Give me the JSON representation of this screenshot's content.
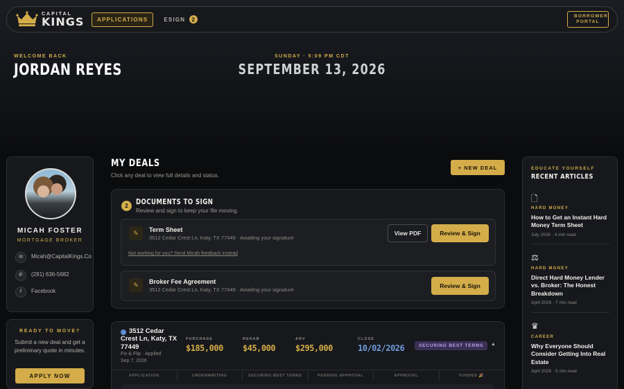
{
  "nav": {
    "logo_top": "CAPITAL",
    "logo_bottom": "KINGS",
    "tabs": [
      {
        "label": "APPLICATIONS",
        "active": true
      },
      {
        "label": "ESIGN",
        "badge": "2"
      }
    ],
    "portal_line1": "BORROWER",
    "portal_line2": "PORTAL"
  },
  "hero": {
    "welcome": "WELCOME BACK",
    "name": "JORDAN REYES",
    "daytime": "SUNDAY · 5:09 PM CDT",
    "date": "SEPTEMBER 13, 2026"
  },
  "profile": {
    "name": "MICAH FOSTER",
    "role": "MORTGAGE BROKER",
    "contacts": [
      {
        "icon": "mail-icon",
        "text": "Micah@CapitalKings.Co"
      },
      {
        "icon": "phone-icon",
        "text": "(281) 636-5682"
      },
      {
        "icon": "facebook-icon",
        "text": "Facebook"
      }
    ]
  },
  "cta": {
    "title": "READY TO MOVE?",
    "text": "Submit a new deal and get a preliminary quote in minutes.",
    "button": "APPLY NOW"
  },
  "main": {
    "title": "MY DEALS",
    "subtitle": "Click any deal to view full details and status.",
    "new_deal": "+ NEW DEAL"
  },
  "docs": {
    "count": "2",
    "title": "DOCUMENTS TO SIGN",
    "subtitle": "Review and sign to keep your file moving.",
    "items": [
      {
        "name": "Term Sheet",
        "meta": "3512 Cedar Crest Ln, Katy, TX 77449 · Awaiting your signature",
        "view": "View PDF",
        "sign": "Review & Sign",
        "feedback": "Not working for you? Send Micah feedback instead"
      },
      {
        "name": "Broker Fee Agreement",
        "meta": "3512 Cedar Crest Ln, Katy, TX 77449 · Awaiting your signature",
        "sign": "Review & Sign"
      }
    ]
  },
  "deal": {
    "address": "3512 Cedar Crest Ln, Katy, TX 77449",
    "type_line": "Fix & Flip · Applied",
    "date_line": "Sep 7, 2026",
    "stats": [
      {
        "label": "PURCHASE",
        "value": "$185,000"
      },
      {
        "label": "REHAB",
        "value": "$45,000"
      },
      {
        "label": "ARV",
        "value": "$295,000"
      },
      {
        "label": "CLOSE",
        "value": "10/02/2026"
      }
    ],
    "status": "SECURING BEST TERMS",
    "steps": [
      "APPLICATION",
      "UNDERWRITING",
      "SECURING BEST TERMS",
      "PENDING APPROVAL",
      "APPROVAL",
      "FUNDED 🎉"
    ]
  },
  "articles": {
    "eyebrow": "EDUCATE YOURSELF",
    "title": "RECENT ARTICLES",
    "items": [
      {
        "icon": "document-icon",
        "category": "HARD MONEY",
        "title": "How to Get an Instant Hard Money Term Sheet",
        "meta": "July 2026 · 4 min read"
      },
      {
        "icon": "scales-icon",
        "category": "HARD MONEY",
        "title": "Direct Hard Money Lender vs. Broker: The Honest Breakdown",
        "meta": "April 2026 · 7 min read"
      },
      {
        "icon": "crown-icon",
        "category": "CAREER",
        "title": "Why Everyone Should Consider Getting Into Real Estate",
        "meta": "April 2026 · 5 min read"
      }
    ]
  },
  "colors": {
    "accent": "#d4ad4a",
    "background": "#0b0c0e",
    "status_purple": "#3a2f55",
    "close_blue": "#6f9ad9"
  }
}
